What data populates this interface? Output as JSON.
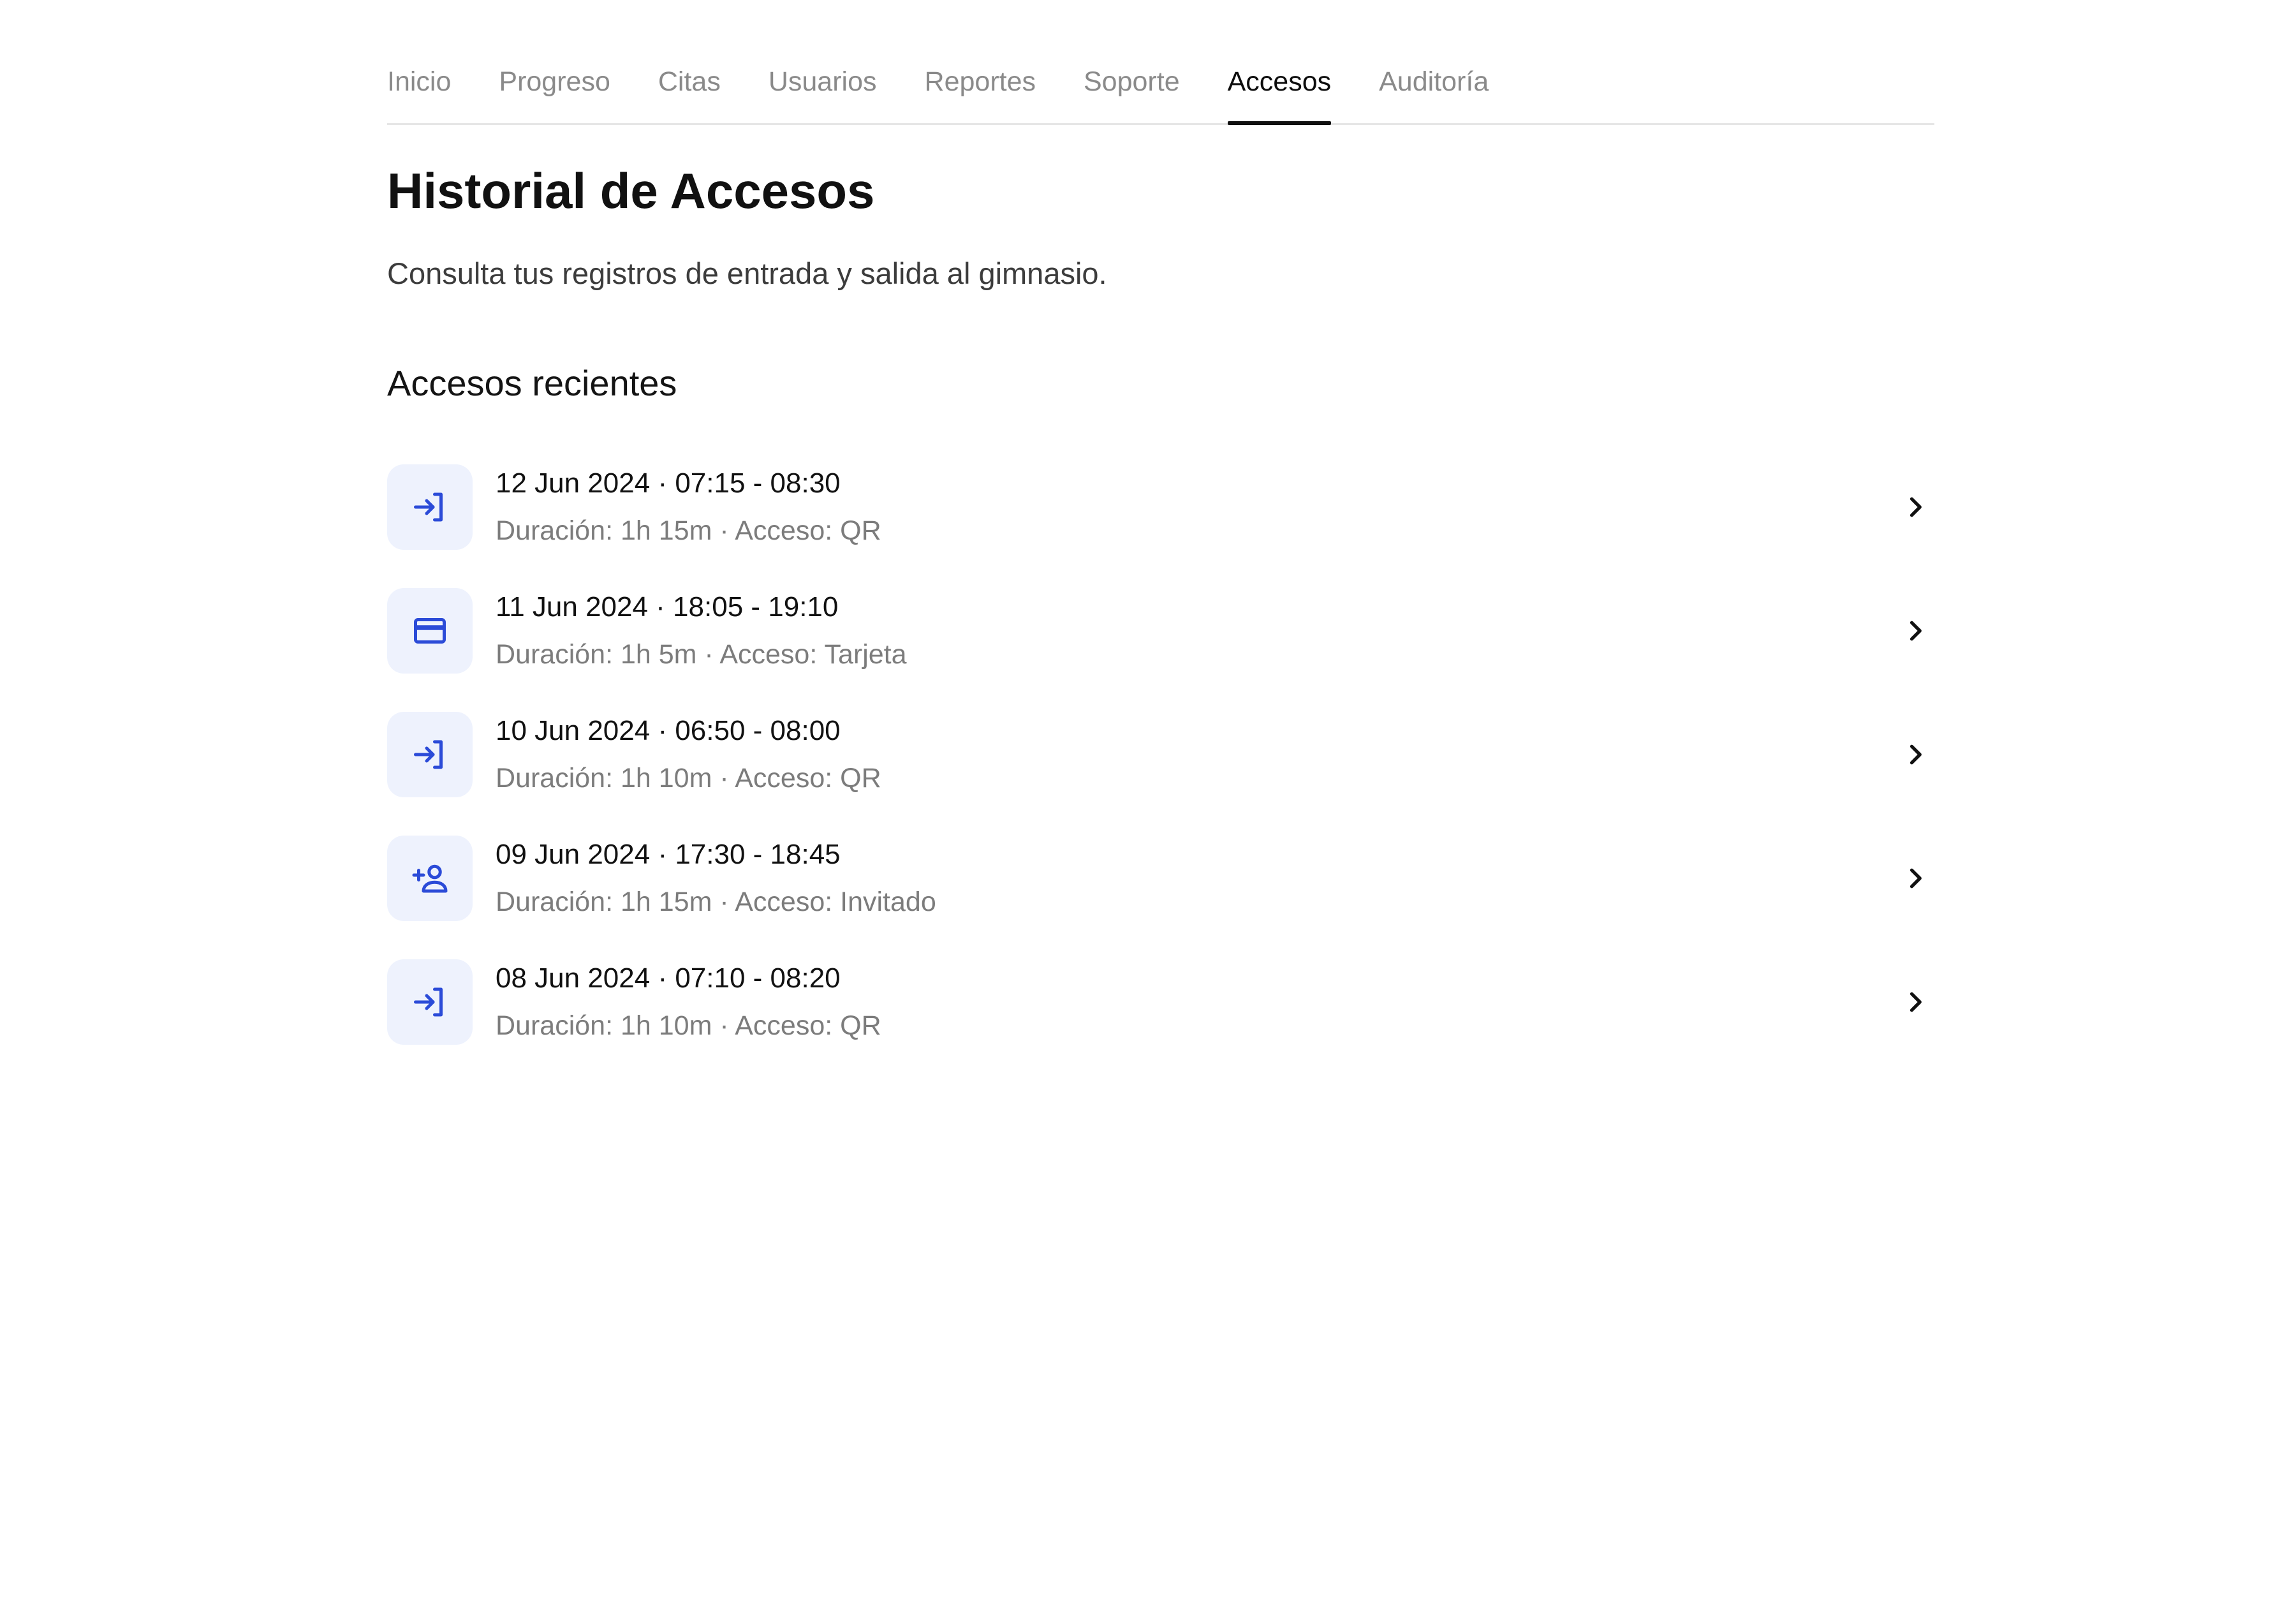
{
  "nav": {
    "tabs": [
      {
        "label": "Inicio"
      },
      {
        "label": "Progreso"
      },
      {
        "label": "Citas"
      },
      {
        "label": "Usuarios"
      },
      {
        "label": "Reportes"
      },
      {
        "label": "Soporte"
      },
      {
        "label": "Accesos",
        "active": true
      },
      {
        "label": "Auditoría"
      }
    ]
  },
  "header": {
    "title": "Historial de Accesos",
    "subtitle": "Consulta tus registros de entrada y salida al gimnasio."
  },
  "section": {
    "title": "Accesos recientes"
  },
  "accesses": [
    {
      "title": "12 Jun 2024 · 07:15 - 08:30",
      "detail": "Duración: 1h 15m · Acceso: QR",
      "icon": "login-icon"
    },
    {
      "title": "11 Jun 2024 · 18:05 - 19:10",
      "detail": "Duración: 1h 5m · Acceso: Tarjeta",
      "icon": "credit-card-icon"
    },
    {
      "title": "10 Jun 2024 · 06:50 - 08:00",
      "detail": "Duración: 1h 10m · Acceso: QR",
      "icon": "login-icon"
    },
    {
      "title": "09 Jun 2024 · 17:30 - 18:45",
      "detail": "Duración: 1h 15m · Acceso: Invitado",
      "icon": "person-add-icon"
    },
    {
      "title": "08 Jun 2024 · 07:10 - 08:20",
      "detail": "Duración: 1h 10m · Acceso: QR",
      "icon": "login-icon"
    }
  ],
  "colors": {
    "accent": "#2b4bd8",
    "icon_bg": "#eef2fd",
    "muted_text": "#7c7c7c",
    "tab_inactive": "#8a8a8a"
  }
}
